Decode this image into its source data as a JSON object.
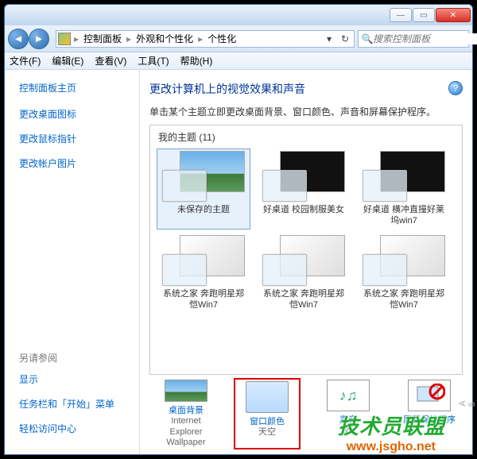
{
  "breadcrumb": {
    "a": "控制面板",
    "b": "外观和个性化",
    "c": "个性化"
  },
  "search": {
    "placeholder": "搜索控制面板"
  },
  "menu": {
    "file": "文件(F)",
    "edit": "编辑(E)",
    "view": "查看(V)",
    "tools": "工具(T)",
    "help": "帮助(H)"
  },
  "sidebar": {
    "home": "控制面板主页",
    "links": [
      "更改桌面图标",
      "更改鼠标指针",
      "更改帐户图片"
    ],
    "see_also_title": "另请参阅",
    "see_also": [
      "显示",
      "任务栏和「开始」菜单",
      "轻松访问中心"
    ]
  },
  "main": {
    "title": "更改计算机上的视觉效果和声音",
    "subtitle": "单击某个主题立即更改桌面背景、窗口颜色、声音和屏幕保护程序。",
    "group": "我的主题 (11)",
    "themes": {
      "t0": "未保存的主题",
      "t1": "好桌道 校园制服美女",
      "t2": "好桌道 横冲直撞好莱坞win7",
      "t3": "系统之家 奔跑明星郑恺Win7",
      "t4": "系统之家 奔跑明星郑恺Win7",
      "t5": "系统之家 奔跑明星郑恺Win7"
    }
  },
  "bottom": {
    "b0": {
      "title": "桌面背景",
      "sub": "Internet Explorer Wallpaper"
    },
    "b1": {
      "title": "窗口颜色",
      "sub": "天空"
    },
    "b2": {
      "title": "声音",
      "sub": "W"
    },
    "b3": {
      "title": "屏幕保护程序",
      "sub": ""
    }
  },
  "watermark": {
    "big": "技术员联盟",
    "url": "www.jsgho.net",
    "side": "A 5"
  }
}
